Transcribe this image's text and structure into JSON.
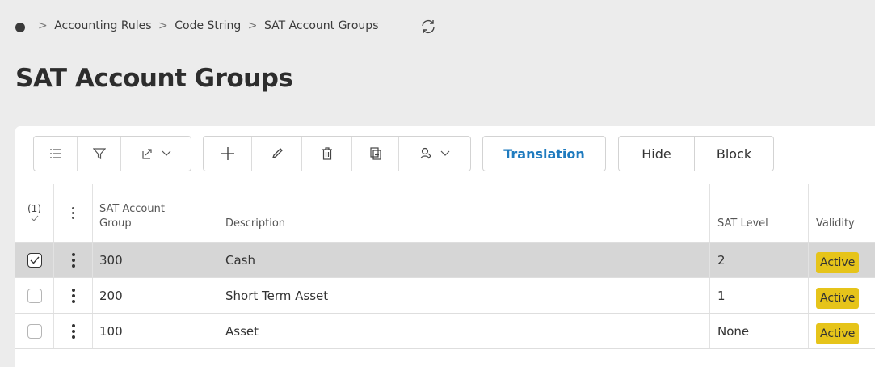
{
  "breadcrumb": {
    "items": [
      "Accounting Rules",
      "Code String",
      "SAT Account Groups"
    ],
    "separator": ">"
  },
  "page": {
    "title": "SAT Account Groups"
  },
  "toolbar": {
    "translation_label": "Translation",
    "hide_label": "Hide",
    "block_label": "Block"
  },
  "table": {
    "selected_count": "(1)",
    "columns": {
      "group_line1": "SAT Account",
      "group_line2": "Group",
      "description": "Description",
      "level": "SAT Level",
      "validity": "Validity"
    },
    "rows": [
      {
        "group": "300",
        "description": "Cash",
        "level": "2",
        "validity": "Active",
        "selected": true
      },
      {
        "group": "200",
        "description": "Short Term Asset",
        "level": "1",
        "validity": "Active",
        "selected": false
      },
      {
        "group": "100",
        "description": "Asset",
        "level": "None",
        "validity": "Active",
        "selected": false
      }
    ]
  },
  "colors": {
    "badge": "#e6c41a",
    "accent": "#1f7bbf",
    "selected_row": "#d6d6d6"
  }
}
